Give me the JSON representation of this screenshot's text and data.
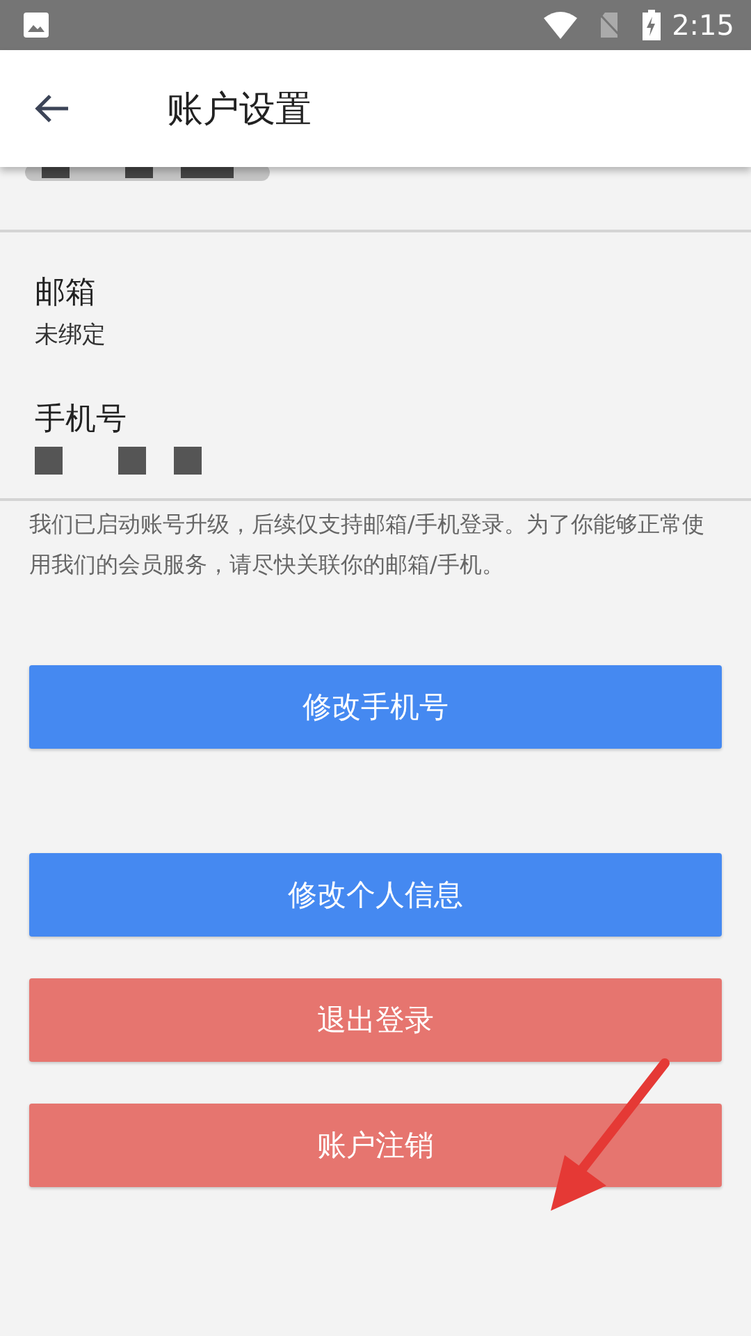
{
  "status_bar": {
    "time": "2:15"
  },
  "header": {
    "title": "账户设置"
  },
  "fields": [
    {
      "kind": "text",
      "label": "邮箱",
      "value": "未绑定"
    },
    {
      "kind": "redacted",
      "label": "手机号"
    }
  ],
  "notice": "我们已启动账号升级，后续仅支持邮箱/手机登录。为了你能够正常使用我们的会员服务，请尽快关联你的邮箱/手机。",
  "buttons": [
    {
      "label": "修改手机号",
      "color": "#4589f1"
    },
    {
      "label": "修改个人信息",
      "color": "#4589f1"
    },
    {
      "label": "退出登录",
      "color": "#e6756f"
    },
    {
      "label": "账户注销",
      "color": "#e6756f"
    }
  ]
}
